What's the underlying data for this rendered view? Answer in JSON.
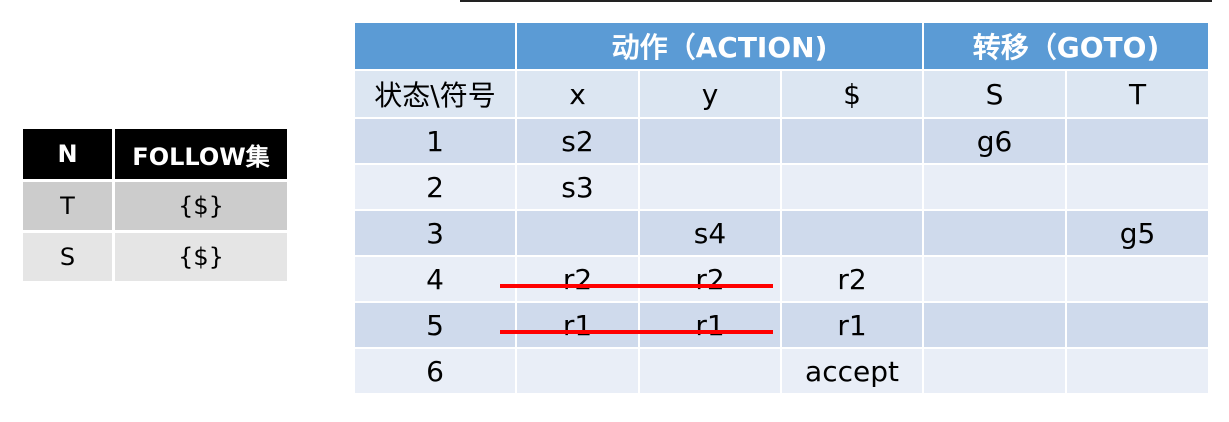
{
  "follow_table": {
    "headers": [
      "N",
      "FOLLOW集"
    ],
    "rows": [
      [
        "T",
        "{$}"
      ],
      [
        "S",
        "{$}"
      ]
    ]
  },
  "lr_table": {
    "group_headers": [
      "",
      "动作（ACTION)",
      "转移（GOTO)"
    ],
    "columns": [
      "状态\\符号",
      "x",
      "y",
      "$",
      "S",
      "T"
    ],
    "rows": [
      [
        "1",
        "s2",
        "",
        "",
        "g6",
        ""
      ],
      [
        "2",
        "s3",
        "",
        "",
        "",
        ""
      ],
      [
        "3",
        "",
        "s4",
        "",
        "",
        "g5"
      ],
      [
        "4",
        "r2",
        "r2",
        "r2",
        "",
        ""
      ],
      [
        "5",
        "r1",
        "r1",
        "r1",
        "",
        ""
      ],
      [
        "6",
        "",
        "",
        "accept",
        "",
        ""
      ]
    ],
    "struck_out_rows": [
      "4",
      "5"
    ],
    "strike_color": "#ff0000"
  }
}
